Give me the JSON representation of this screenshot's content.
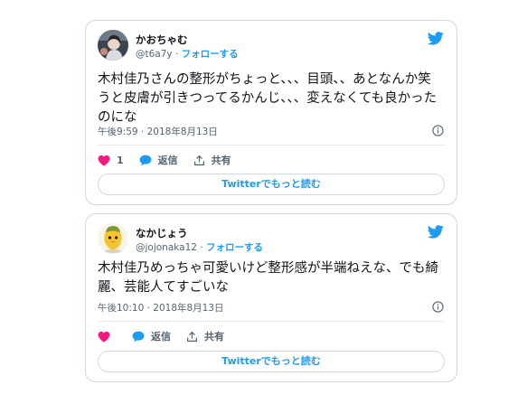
{
  "tweets": [
    {
      "display_name": "かおちゃむ",
      "handle": "@t6a7y",
      "separator": "·",
      "follow_label": "フォローする",
      "text": "木村佳乃さんの整形がちょっと、、、目頭、、あとなんか笑うと皮膚が引きつってるかんじ、、、変えなくても良かったのにな",
      "timestamp": "午後9:59 · 2018年8月13日",
      "like_count": "1",
      "reply_label": "返信",
      "share_label": "共有",
      "read_more_label": "Twitterでもっと読む"
    },
    {
      "display_name": "なかじょう",
      "handle": "@jojonaka12",
      "separator": "·",
      "follow_label": "フォローする",
      "text": "木村佳乃めっちゃ可愛いけど整形感が半端ねえな、でも綺麗、芸能人てすごいな",
      "timestamp": "午後10:10 · 2018年8月13日",
      "like_count": "",
      "reply_label": "返信",
      "share_label": "共有",
      "read_more_label": "Twitterでもっと読む"
    }
  ],
  "icons": {
    "like": "heart-icon",
    "reply": "speech-bubble-icon",
    "share": "share-upload-icon",
    "info": "info-icon",
    "brand": "twitter-bird-icon"
  },
  "colors": {
    "brand_blue": "#1d9bf0",
    "like_pink": "#f91880",
    "text_primary": "#0f1419",
    "text_secondary": "#536471",
    "border": "#cfd9de"
  }
}
